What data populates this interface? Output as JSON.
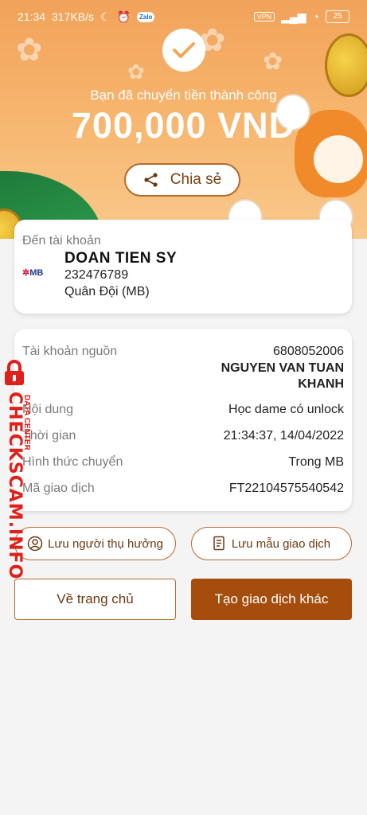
{
  "status_bar": {
    "time": "21:34",
    "speed": "317KB/s",
    "zalo": "Zalo",
    "vpn": "VPN",
    "battery": "25"
  },
  "header": {
    "success_text": "Bạn đã chuyển tiền thành công",
    "amount": "700,000 VND",
    "share_label": "Chia sẻ"
  },
  "destination": {
    "label": "Đến tài khoản",
    "bank_logo": "MB",
    "name": "DOAN TIEN SY",
    "account": "232476789",
    "bank": "Quân Đội (MB)"
  },
  "details": {
    "source_label": "Tài khoản nguồn",
    "source_account": "6808052006",
    "source_name": "NGUYEN VAN TUAN KHANH",
    "content_label": "Nội dung",
    "content_value": "Học dame có unlock",
    "time_label": "Thời gian",
    "time_value": "21:34:37, 14/04/2022",
    "method_label": "Hình thức chuyển",
    "method_value": "Trong MB",
    "code_label": "Mã giao dịch",
    "code_value": "FT22104575540542"
  },
  "actions": {
    "save_recipient": "Lưu người thụ hưởng",
    "save_template": "Lưu mẫu giao dịch",
    "home": "Về trang chủ",
    "new_transaction": "Tạo giao dịch khác"
  },
  "watermark": {
    "text": "CHECKSCAM.INFO",
    "sub": "DATA CENTER"
  },
  "colors": {
    "accent": "#a54d0c",
    "border": "#b36a2e",
    "watermark": "#e0201a"
  }
}
